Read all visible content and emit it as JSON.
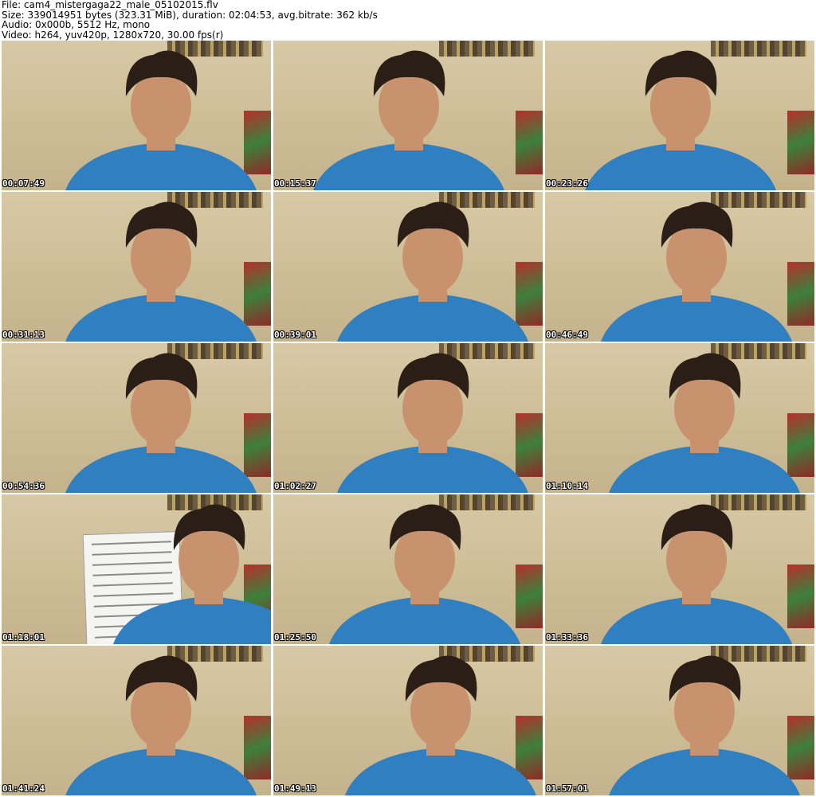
{
  "header": {
    "file": "File: cam4_mistergaga22_male_05102015.flv",
    "size": "Size: 339014951 bytes (323.31 MiB), duration: 02:04:53, avg.bitrate: 362 kb/s",
    "audio": "Audio: 0x000b, 5512 Hz, mono",
    "video": "Video: h264, yuv420p, 1280x720, 30.00 fps(r)"
  },
  "thumbnails": [
    {
      "time": "00:07:49"
    },
    {
      "time": "00:15:37"
    },
    {
      "time": "00:23:26"
    },
    {
      "time": "00:31:13"
    },
    {
      "time": "00:39:01"
    },
    {
      "time": "00:46:49"
    },
    {
      "time": "00:54:36"
    },
    {
      "time": "01:02:27"
    },
    {
      "time": "01:10:14"
    },
    {
      "time": "01:18:01"
    },
    {
      "time": "01:25:50"
    },
    {
      "time": "01:33:36"
    },
    {
      "time": "01:41:24"
    },
    {
      "time": "01:49:13"
    },
    {
      "time": "01:57:01"
    }
  ],
  "colors": {
    "wall": "#d8c9a6",
    "shirt": "#2f7fc1",
    "skin": "#c9926e",
    "hair": "#2a1e17"
  }
}
